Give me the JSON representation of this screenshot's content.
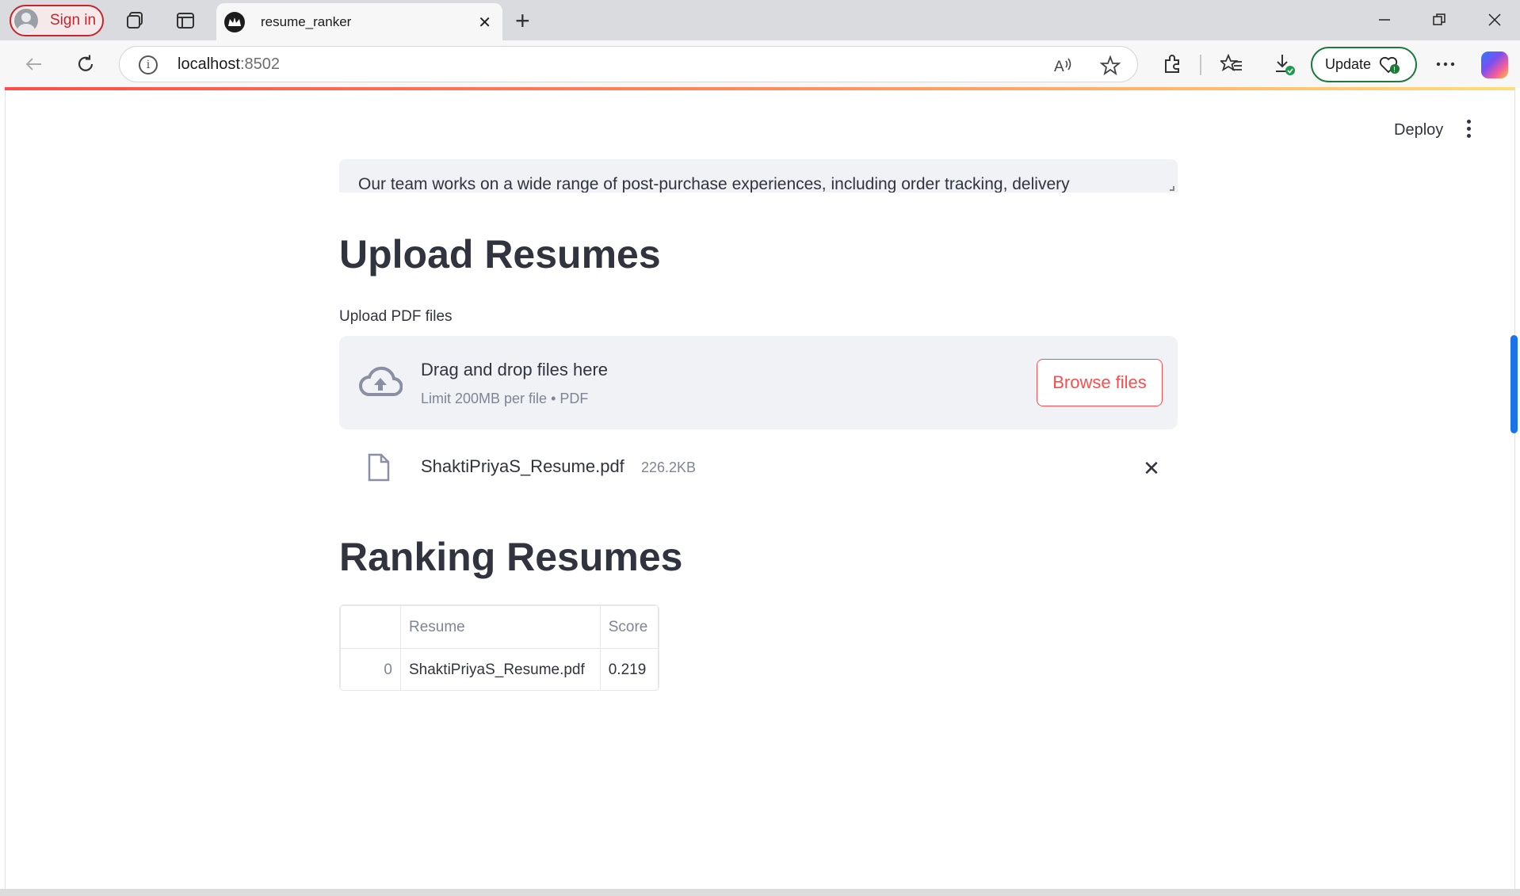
{
  "browser": {
    "sign_in_label": "Sign in",
    "tab_title": "resume_ranker",
    "url_host": "localhost",
    "url_port": ":8502",
    "update_label": "Update",
    "accent_color": "#c4262e"
  },
  "app": {
    "deploy_label": "Deploy",
    "textarea_text": "Our team works on a wide range of post-purchase experiences, including order tracking, delivery",
    "upload_heading": "Upload Resumes",
    "upload_label": "Upload PDF files",
    "dropzone": {
      "title": "Drag and drop files here",
      "subtitle": "Limit 200MB per file • PDF",
      "browse_label": "Browse files"
    },
    "uploaded_file": {
      "name": "ShaktiPriyaS_Resume.pdf",
      "size": "226.2KB"
    },
    "ranking_heading": "Ranking Resumes",
    "table": {
      "columns": [
        "",
        "Resume",
        "Score"
      ],
      "rows": [
        {
          "index": "0",
          "resume": "ShaktiPriyaS_Resume.pdf",
          "score": "0.219"
        }
      ]
    },
    "primary_color": "#ff4b4b",
    "text_color": "#31333f"
  }
}
